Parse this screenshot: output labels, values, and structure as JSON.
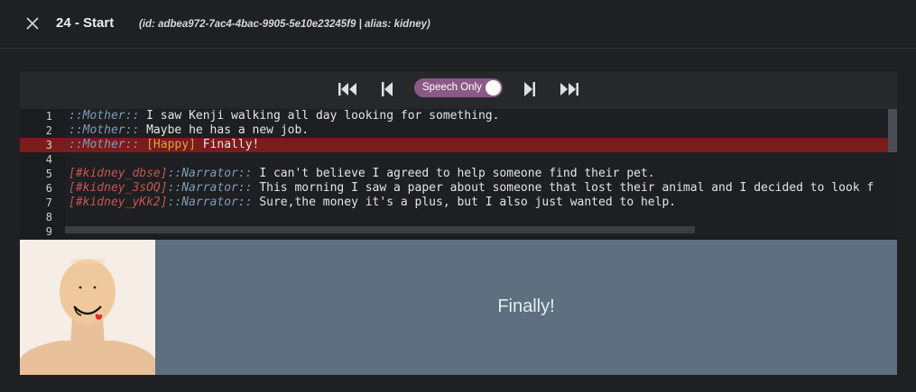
{
  "header": {
    "title": "24 - Start",
    "subtitle": "(id: adbea972-7ac4-4bac-9905-5e10e23245f9 | alias: kidney)"
  },
  "toolbar": {
    "toggle_label": "Speech Only",
    "toggle_on": true,
    "accent_color": "#8a5a87"
  },
  "editor": {
    "active_line": 3,
    "lines": [
      {
        "n": "1",
        "tag": "",
        "speaker": "::Mother::",
        "emotion": "",
        "text": " I saw Kenji walking all day looking for something."
      },
      {
        "n": "2",
        "tag": "",
        "speaker": "::Mother::",
        "emotion": "",
        "text": " Maybe he has a new job."
      },
      {
        "n": "3",
        "tag": "",
        "speaker": "::Mother::",
        "emotion": " [Happy]",
        "text": " Finally!"
      },
      {
        "n": "4",
        "tag": "",
        "speaker": "",
        "emotion": "",
        "text": ""
      },
      {
        "n": "5",
        "tag": "[#kidney_dbse]",
        "speaker": "::Narrator::",
        "emotion": "",
        "text": " I can't believe I agreed to help someone find their pet."
      },
      {
        "n": "6",
        "tag": "[#kidney_3sOQ]",
        "speaker": "::Narrator::",
        "emotion": "",
        "text": " This morning I saw a paper about someone that lost their animal and I decided to look f"
      },
      {
        "n": "7",
        "tag": "[#kidney_yKk2]",
        "speaker": "::Narrator::",
        "emotion": "",
        "text": " Sure,the money it's a plus, but I also just wanted to help."
      },
      {
        "n": "8",
        "tag": "",
        "speaker": "",
        "emotion": "",
        "text": ""
      },
      {
        "n": "9",
        "tag": "",
        "speaker": "",
        "emotion": "",
        "text": ""
      }
    ]
  },
  "preview": {
    "dialog_text": "Finally!",
    "dialog_bg": "#5e7080"
  }
}
